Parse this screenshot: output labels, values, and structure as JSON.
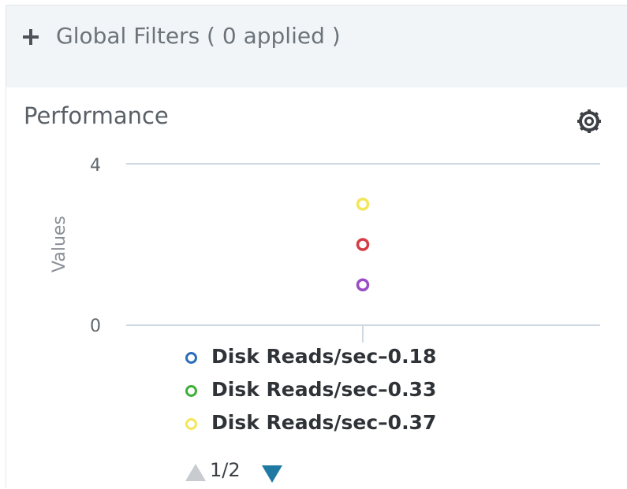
{
  "filters": {
    "label": "Global Filters ( 0 applied )",
    "icon": "plus-icon"
  },
  "panel": {
    "title": "Performance",
    "settings_icon": "gear-icon"
  },
  "chart_data": {
    "type": "scatter",
    "ylabel": "Values",
    "xlabel": "",
    "ylim": [
      0,
      4
    ],
    "y_ticks": [
      "4",
      "0"
    ],
    "points": [
      {
        "y": 3,
        "color": "#f3e65a"
      },
      {
        "y": 2,
        "color": "#d63c46"
      },
      {
        "y": 1,
        "color": "#9a4dc4"
      }
    ],
    "grid": true
  },
  "legend": {
    "items": [
      {
        "label": "Disk Reads/sec–0.18",
        "color": "#2e6db8"
      },
      {
        "label": "Disk Reads/sec–0.33",
        "color": "#3fae3a"
      },
      {
        "label": "Disk Reads/sec–0.37",
        "color": "#f3e65a"
      }
    ],
    "pager": {
      "text": "1/2",
      "prev_color": "#c8cbcf",
      "next_color": "#1f7aa3"
    }
  }
}
